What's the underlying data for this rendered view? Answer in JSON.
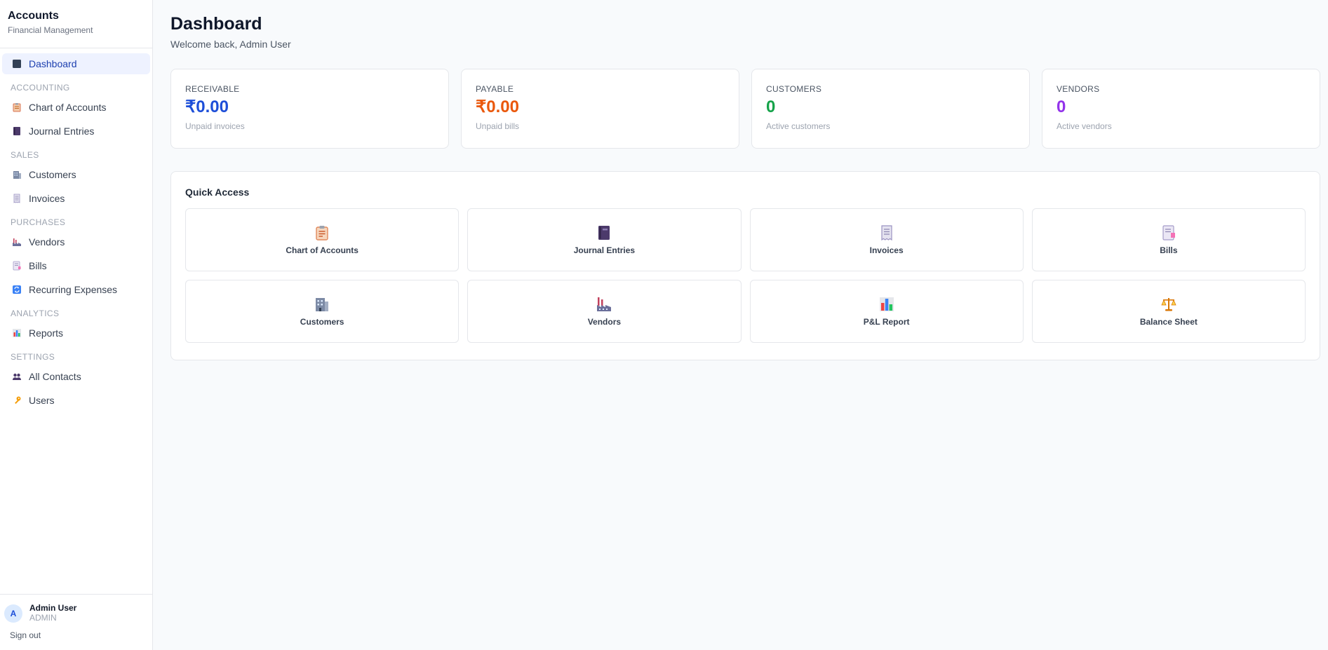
{
  "brand": {
    "title": "Accounts",
    "subtitle": "Financial Management"
  },
  "nav": {
    "dashboard": "Dashboard",
    "sections": {
      "accounting": "ACCOUNTING",
      "sales": "SALES",
      "purchases": "PURCHASES",
      "analytics": "ANALYTICS",
      "settings": "SETTINGS"
    },
    "items": {
      "chart_of_accounts": "Chart of Accounts",
      "journal_entries": "Journal Entries",
      "customers": "Customers",
      "invoices": "Invoices",
      "vendors": "Vendors",
      "bills": "Bills",
      "recurring_expenses": "Recurring Expenses",
      "reports": "Reports",
      "all_contacts": "All Contacts",
      "users": "Users"
    }
  },
  "user": {
    "initial": "A",
    "name": "Admin User",
    "role": "ADMIN",
    "signout": "Sign out"
  },
  "page": {
    "title": "Dashboard",
    "subtitle": "Welcome back, Admin User"
  },
  "stats": [
    {
      "label": "RECEIVABLE",
      "value": "₹0.00",
      "note": "Unpaid invoices",
      "color": "#1d4ed8"
    },
    {
      "label": "PAYABLE",
      "value": "₹0.00",
      "note": "Unpaid bills",
      "color": "#ea580c"
    },
    {
      "label": "CUSTOMERS",
      "value": "0",
      "note": "Active customers",
      "color": "#16a34a"
    },
    {
      "label": "VENDORS",
      "value": "0",
      "note": "Active vendors",
      "color": "#9333ea"
    }
  ],
  "quick_access": {
    "title": "Quick Access",
    "tiles": [
      {
        "label": "Chart of Accounts",
        "icon": "clipboard-icon"
      },
      {
        "label": "Journal Entries",
        "icon": "notebook-icon"
      },
      {
        "label": "Invoices",
        "icon": "receipt-icon"
      },
      {
        "label": "Bills",
        "icon": "bill-icon"
      },
      {
        "label": "Customers",
        "icon": "office-building-icon"
      },
      {
        "label": "Vendors",
        "icon": "factory-icon"
      },
      {
        "label": "P&L Report",
        "icon": "bar-chart-icon"
      },
      {
        "label": "Balance Sheet",
        "icon": "scales-icon"
      }
    ]
  }
}
